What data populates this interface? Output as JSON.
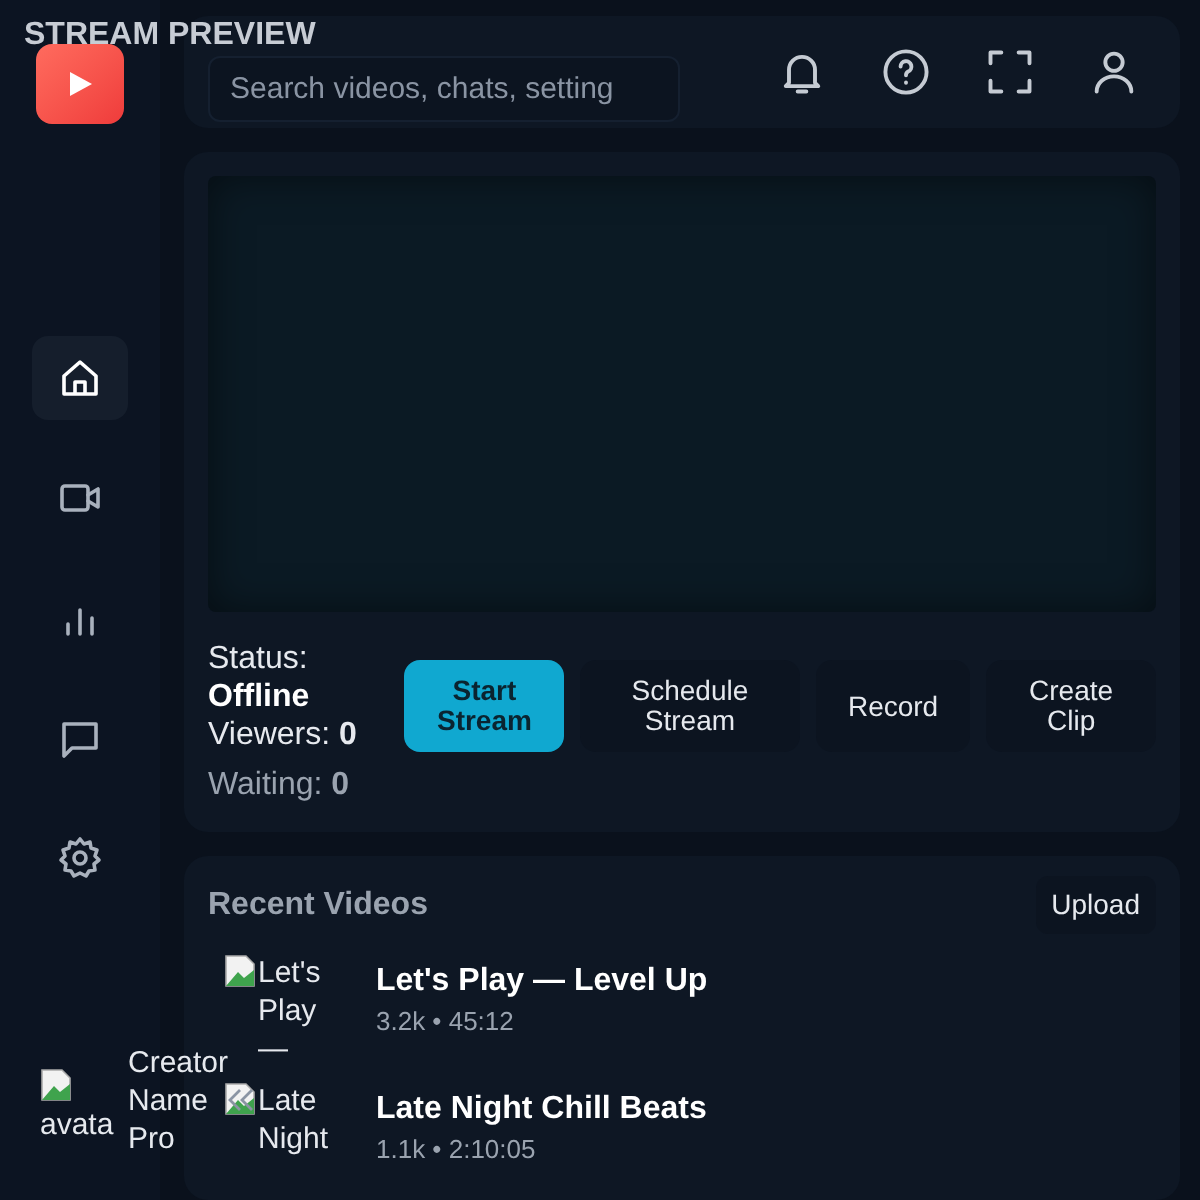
{
  "app_title": "STREAM PREVIEW",
  "search": {
    "placeholder": "Search videos, chats, setting"
  },
  "sidebar": {
    "items": [
      {
        "kind": "home",
        "selected": true
      },
      {
        "kind": "video",
        "selected": false
      },
      {
        "kind": "chart",
        "selected": false
      },
      {
        "kind": "chat",
        "selected": false
      },
      {
        "kind": "settings",
        "selected": false
      }
    ]
  },
  "user": {
    "avatar_alt": "avata",
    "name": "Creator Name",
    "plan": "Pro"
  },
  "status": {
    "label": "Status:",
    "value": "Offline",
    "viewers_label": "Viewers:",
    "viewers": "0",
    "waiting_label": "Waiting:",
    "waiting": "0"
  },
  "actions": [
    {
      "label": "Start Stream",
      "primary": true
    },
    {
      "label": "Schedule Stream",
      "primary": false
    },
    {
      "label": "Record",
      "primary": false
    },
    {
      "label": "Create Clip",
      "primary": false
    }
  ],
  "recent": {
    "title": "Recent Videos",
    "upload": "Upload",
    "videos": [
      {
        "thumb_alt": "Let's Play —",
        "title": "Let's Play — Level Up",
        "meta": "3.2k • 45:12"
      },
      {
        "thumb_alt": "Late Night",
        "title": "Late Night Chill Beats",
        "meta": "1.1k • 2:10:05"
      }
    ]
  }
}
